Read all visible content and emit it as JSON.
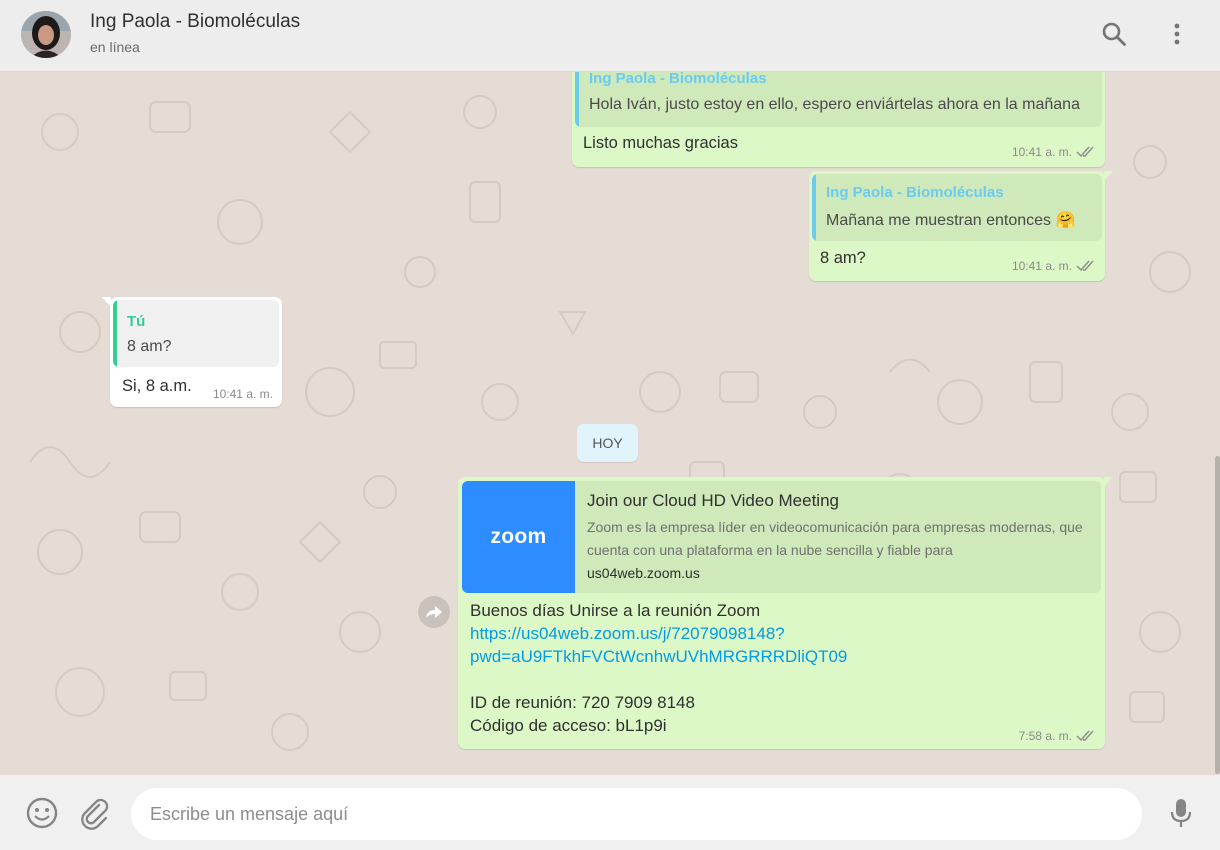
{
  "header": {
    "contact_name": "Ing Paola - Biomoléculas",
    "status": "en línea",
    "icons": [
      "search-icon",
      "menu-icon"
    ]
  },
  "messages": [
    {
      "direction": "outgoing",
      "quote_author": "Ing Paola - Biomoléculas",
      "quote_text": "Hola Iván, justo estoy en ello, espero enviártelas ahora en la mañana",
      "text": "Listo muchas gracias",
      "time": "10:41 a. m."
    },
    {
      "direction": "outgoing",
      "quote_author": "Ing Paola - Biomoléculas",
      "quote_text": "Mañana me muestran entonces 🤗",
      "text": "8 am?",
      "time": "10:41 a. m."
    },
    {
      "direction": "incoming",
      "quote_author": "Tú",
      "quote_text": "8 am?",
      "text": "Si, 8 a.m.",
      "time": "10:41 a. m."
    },
    {
      "direction": "outgoing",
      "link_preview": {
        "thumb_label": "zoom",
        "title": "Join our Cloud HD Video Meeting",
        "description": "Zoom es la empresa líder en videocomunicación para empresas modernas, que cuenta con una plataforma en la nube sencilla y fiable para",
        "domain": "us04web.zoom.us"
      },
      "lines": [
        "Buenos días Unirse a la reunión Zoom",
        "https://us04web.zoom.us/j/72079098148?",
        "pwd=aU9FTkhFVCtWcnhwUVhMRGRRRDliQT09",
        "",
        "ID de reunión: 720 7909 8148",
        "Código de acceso: bL1p9i"
      ],
      "time": "7:58 a. m."
    }
  ],
  "day_chip": "HOY",
  "footer": {
    "placeholder": "Escribe un mensaje aquí",
    "icons": [
      "emoji-icon",
      "attach-icon",
      "microphone-icon"
    ]
  },
  "colors": {
    "outgoing_bubble": "#dcf8c6",
    "incoming_bubble": "#ffffff",
    "quote_author_blue": "#6bcbef",
    "quote_author_green": "#35cd96",
    "link": "#039be5",
    "chat_bg": "#e5ddd5",
    "read_ticks": "#8a8a8a"
  }
}
